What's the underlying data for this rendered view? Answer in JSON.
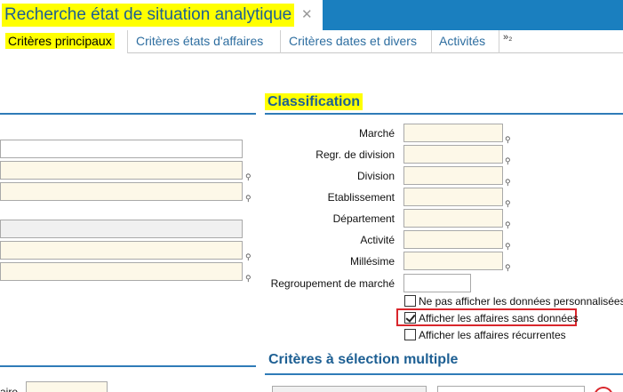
{
  "window": {
    "title": "Recherche état de situation analytique",
    "close_glyph": "✕"
  },
  "tabs": [
    {
      "label": "Critères principaux"
    },
    {
      "label": "Critères états d'affaires"
    },
    {
      "label": "Critères dates et divers"
    },
    {
      "label": "Activités"
    }
  ],
  "tab_more": "»₂",
  "classification": {
    "heading": "Classification",
    "fields": [
      {
        "label": "Marché"
      },
      {
        "label": "Regr. de division"
      },
      {
        "label": "Division"
      },
      {
        "label": "Etablissement"
      },
      {
        "label": "Département"
      },
      {
        "label": "Activité"
      },
      {
        "label": "Millésime"
      },
      {
        "label": "Regroupement de marché"
      }
    ],
    "checkboxes": [
      {
        "label": "Ne pas afficher les données personnalisées",
        "checked": false
      },
      {
        "label": "Afficher les affaires sans données",
        "checked": true
      },
      {
        "label": "Afficher les affaires récurrentes",
        "checked": false
      }
    ]
  },
  "multi_selection": {
    "heading": "Critères à sélection multiple"
  },
  "left_partial_label": "aire",
  "colors": {
    "accent_blue": "#1a7fbf",
    "highlight_yellow": "#ffff00",
    "input_bg": "#fdf8e8",
    "highlight_border": "#d9262c"
  }
}
